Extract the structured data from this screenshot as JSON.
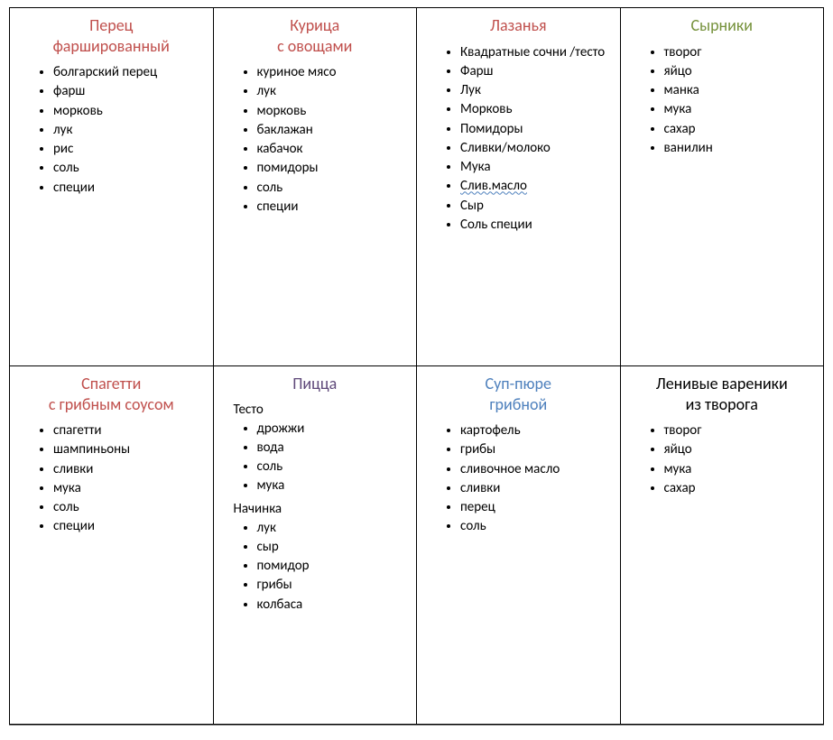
{
  "cells": [
    {
      "title": "Перец\nфарширован­ный",
      "title_color": "clr-brick",
      "title_name": "recipe-title-perets-farshirovannyy",
      "sections": [
        {
          "items": [
            "болгарский перец",
            "фарш",
            "морковь",
            "лук",
            "рис",
            "соль",
            "специи"
          ]
        }
      ]
    },
    {
      "title": "Курица\nс овощами",
      "title_color": "clr-brick",
      "title_name": "recipe-title-kuritsa-s-ovoshchami",
      "sections": [
        {
          "items": [
            "куриное мясо",
            "лук",
            "морковь",
            "баклажан",
            "кабачок",
            "помидоры",
            "соль",
            "специи"
          ]
        }
      ]
    },
    {
      "title": "Лазанья",
      "title_color": "clr-brick",
      "title_name": "recipe-title-lazanya",
      "sections": [
        {
          "items": [
            "Квадратные сочни /тесто",
            "Фарш",
            "Лук",
            "Морковь",
            "Помидоры",
            "Сливки/молоко",
            "Мука",
            "Слив.масло",
            "Сыр",
            "Соль специи"
          ]
        }
      ],
      "spellcheck_items": [
        "Слив.масло"
      ]
    },
    {
      "title": "Сырники",
      "title_color": "clr-green",
      "title_name": "recipe-title-syrniki",
      "sections": [
        {
          "items": [
            "творог",
            "яйцо",
            "манка",
            "мука",
            "сахар",
            "ванилин"
          ]
        }
      ]
    },
    {
      "title": "Спагетти\nс грибным соусом",
      "title_color": "clr-brick",
      "title_name": "recipe-title-spagetti-s-gribnym-sousom",
      "sections": [
        {
          "items": [
            "спагетти",
            "шампиньоны",
            "сливки",
            "мука",
            "соль",
            "специи"
          ]
        }
      ]
    },
    {
      "title": "Пицца",
      "title_color": "clr-purple",
      "title_name": "recipe-title-pitstsa",
      "sections": [
        {
          "label": "Тесто",
          "items": [
            "дрожжи",
            "вода",
            "соль",
            "мука"
          ]
        },
        {
          "label": "Начинка",
          "items": [
            "лук",
            "сыр",
            "помидор",
            "грибы",
            "колбаса"
          ]
        }
      ]
    },
    {
      "title": "Суп-пюре\nгрибной",
      "title_color": "clr-blue",
      "title_name": "recipe-title-sup-pyure-gribnoy",
      "sections": [
        {
          "items": [
            "картофель",
            "грибы",
            "сливочное масло",
            "сливки",
            "перец",
            "соль"
          ]
        }
      ]
    },
    {
      "title": "Ленивые вареники\nиз творога",
      "title_color": "clr-black",
      "title_name": "recipe-title-lenivye-vareniki",
      "sections": [
        {
          "items": [
            "творог",
            "яйцо",
            "мука",
            "сахар"
          ]
        }
      ]
    }
  ]
}
